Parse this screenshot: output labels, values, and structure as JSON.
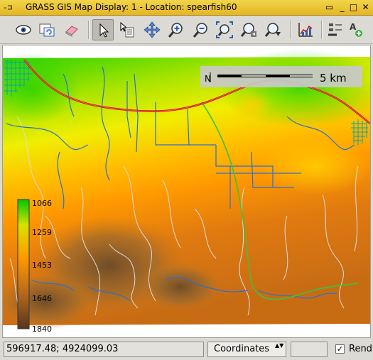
{
  "window": {
    "icon": "-⊐",
    "title": "GRASS GIS Map Display: 1  - Location: spearfish60",
    "buttons": {
      "shade": "▭",
      "minimize": "_",
      "maximize": "□",
      "close": "✕"
    }
  },
  "toolbar": {
    "tools": [
      {
        "name": "display-map",
        "icon": "eye-icon"
      },
      {
        "name": "render-map",
        "icon": "render-icon"
      },
      {
        "name": "erase-display",
        "icon": "eraser-icon"
      },
      {
        "name": "pointer",
        "icon": "pointer-arrow-icon",
        "active": true
      },
      {
        "name": "query",
        "icon": "query-icon"
      },
      {
        "name": "pan",
        "icon": "pan-arrows-icon"
      },
      {
        "name": "zoom-in",
        "icon": "zoom-in-icon"
      },
      {
        "name": "zoom-out",
        "icon": "zoom-out-icon"
      },
      {
        "name": "zoom-extent",
        "icon": "zoom-extent-icon"
      },
      {
        "name": "zoom-back",
        "icon": "zoom-back-icon"
      },
      {
        "name": "zoom-options",
        "icon": "zoom-options-icon"
      },
      {
        "name": "analyze",
        "icon": "analyze-chart-icon"
      },
      {
        "name": "overlay-decorations",
        "icon": "overlay-icon"
      },
      {
        "name": "add-text",
        "icon": "text-add-icon"
      }
    ]
  },
  "map": {
    "location": "spearfish60",
    "scalebar": {
      "label": "5  km",
      "north_symbol": "N"
    },
    "legend": {
      "values": [
        "1066",
        "1259",
        "1453",
        "1646",
        "1840"
      ],
      "colors": [
        "#00c800",
        "#d9e000",
        "#ff9a00",
        "#b86a1a",
        "#55351e"
      ]
    },
    "colors": {
      "roads": "#cc1a1a",
      "streams": "#2c6fd1",
      "trails": "#d8d8d8",
      "urban": "#00b0b0"
    }
  },
  "statusbar": {
    "coordinates": "596917.48; 4924099.03",
    "mode": "Coordinates",
    "mode_arrows": "▲▼",
    "render_label": "Rend",
    "render_checked": true,
    "render_mark": "✓"
  }
}
